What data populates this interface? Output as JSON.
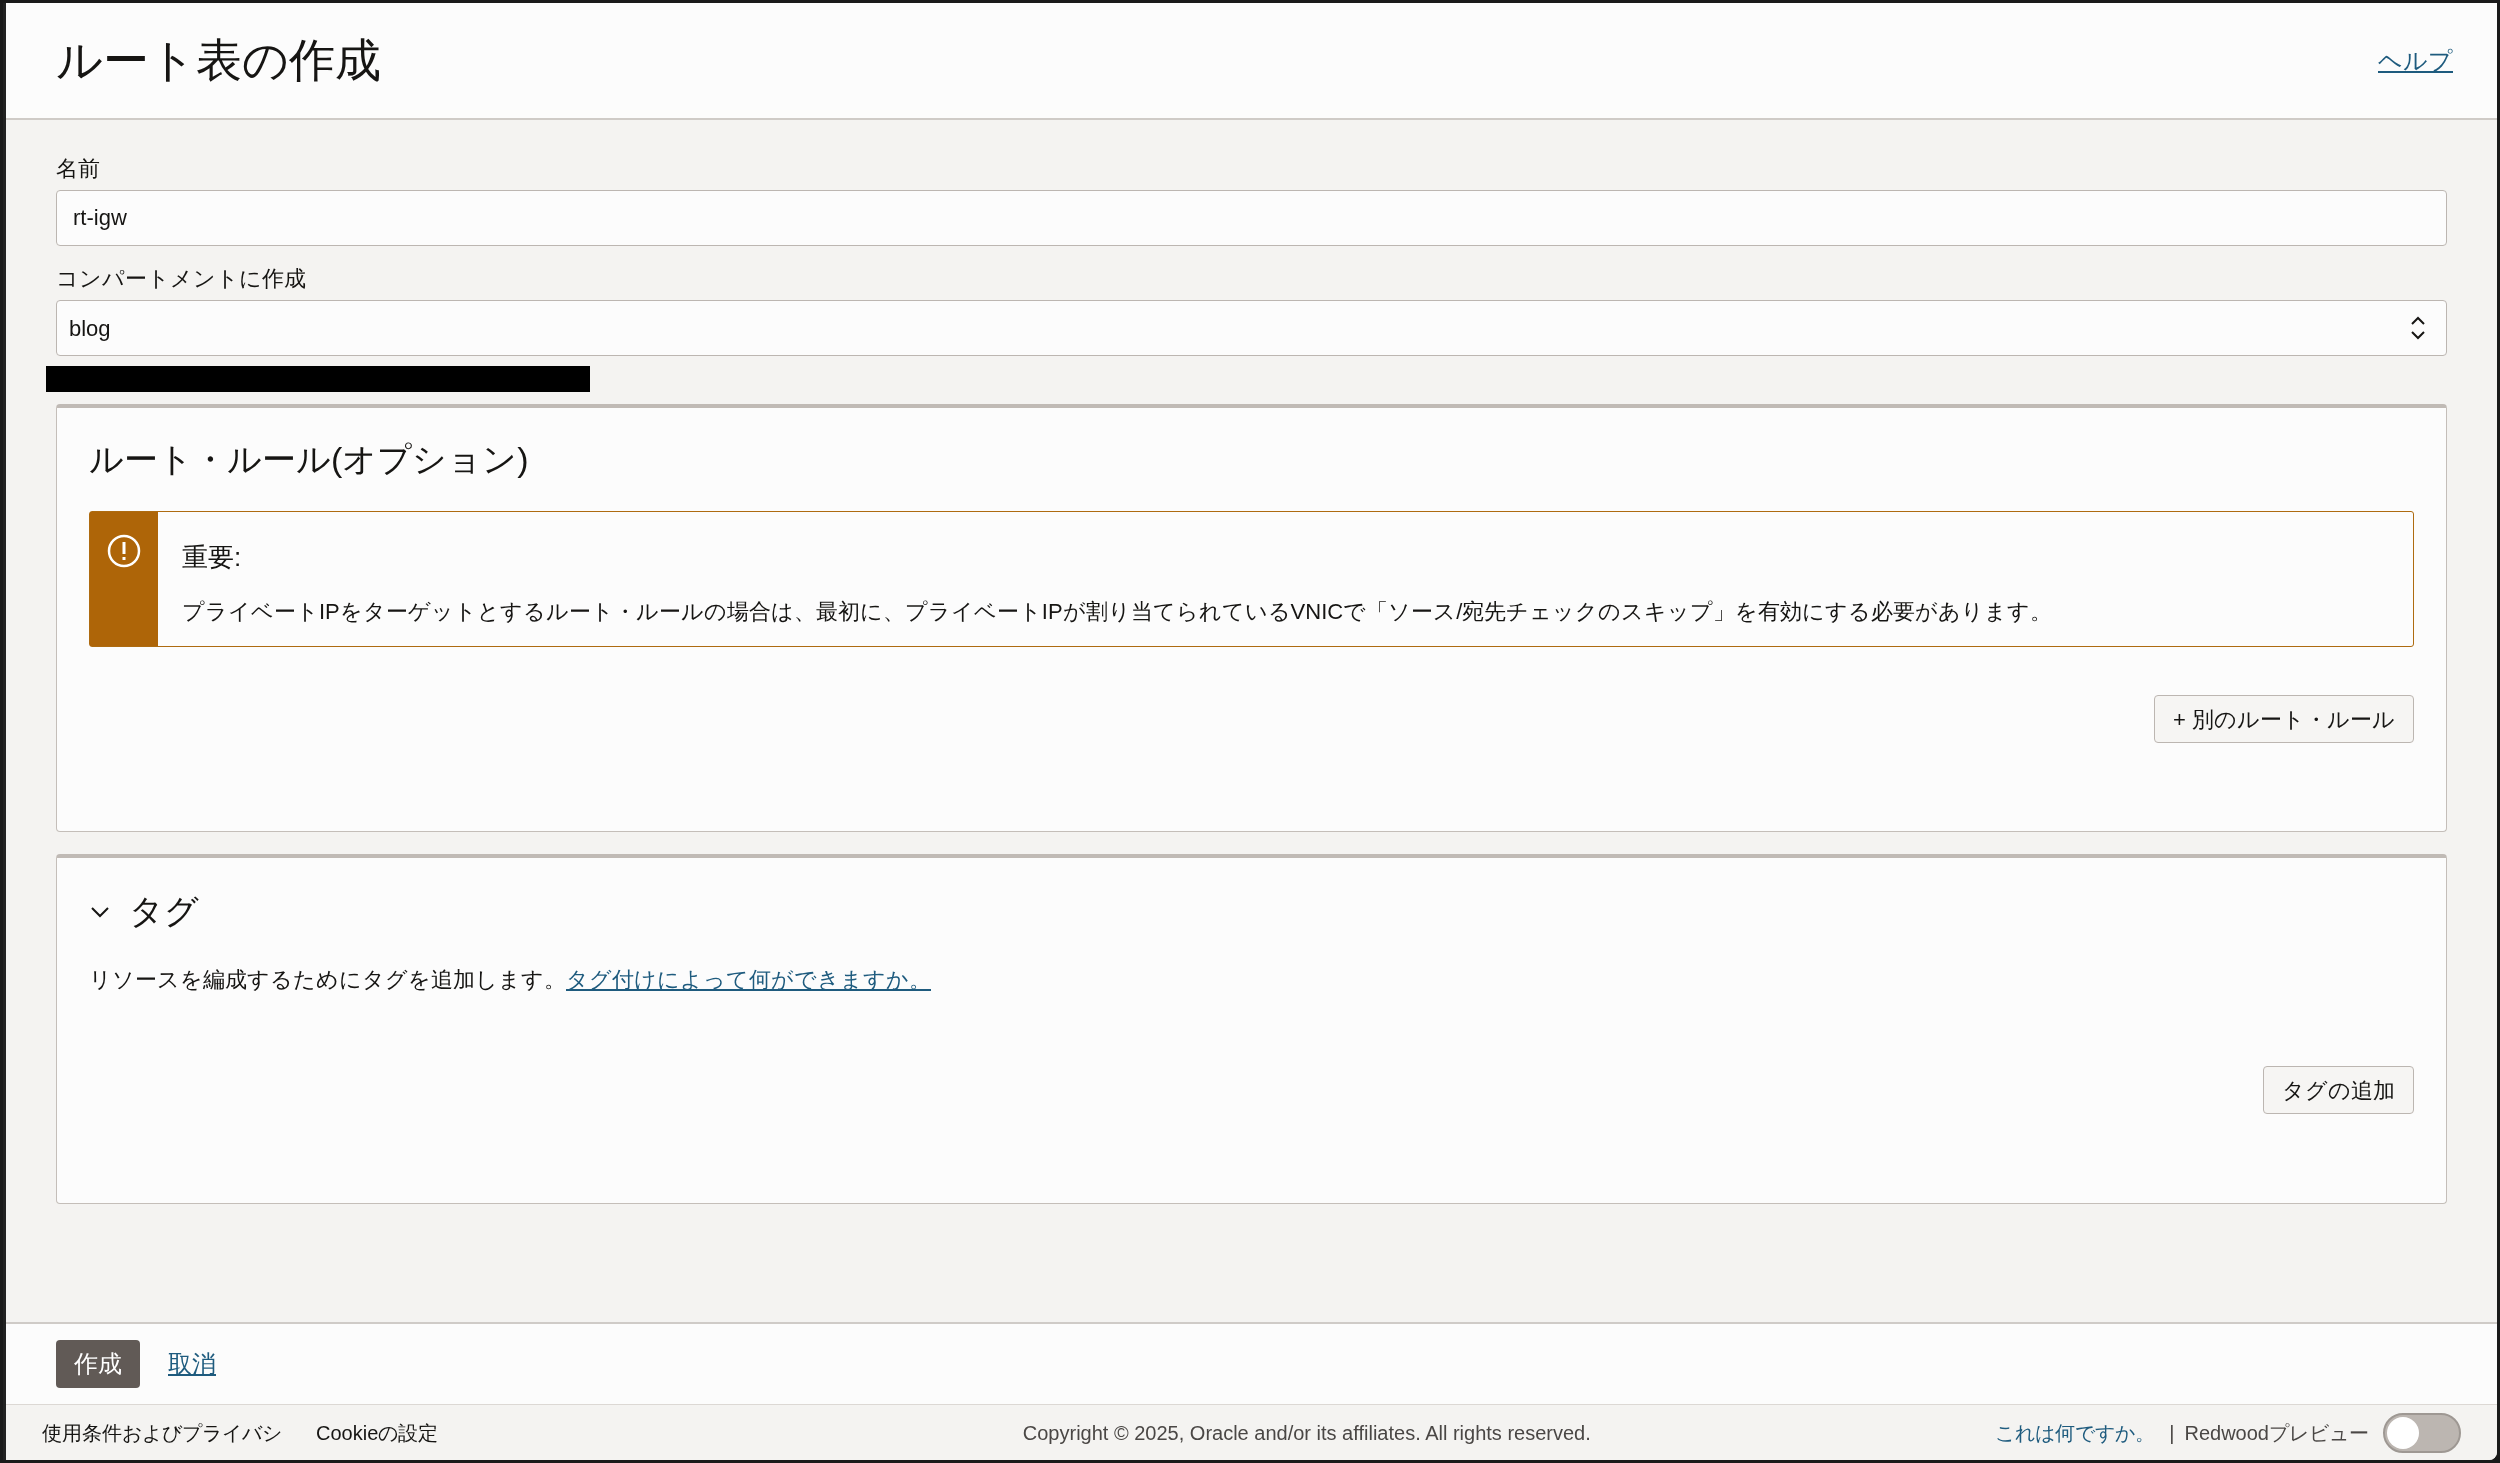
{
  "header": {
    "title": "ルート表の作成",
    "help_link": "ヘルプ"
  },
  "fields": [
    {
      "kind": "text",
      "label": "名前",
      "value": "rt-igw"
    },
    {
      "kind": "select",
      "label": "コンパートメントに作成",
      "value": "blog"
    }
  ],
  "route_rules": {
    "title": "ルート・ルール(オプション)",
    "notice": {
      "title": "重要:",
      "text": "プライベートIPをターゲットとするルート・ルールの場合は、最初に、プライベートIPが割り当てられているVNICで「ソース/宛先チェックのスキップ」を有効にする必要があります。"
    },
    "add_button": "+ 別のルート・ルール"
  },
  "tags": {
    "title": "タグ",
    "expanded": true,
    "description": "リソースを編成するためにタグを追加します。",
    "link": "タグ付けによって何ができますか。",
    "add_button": "タグの追加"
  },
  "actions": {
    "create": "作成",
    "cancel": "取消"
  },
  "footer": {
    "terms": "使用条件およびプライバシ",
    "cookies": "Cookieの設定",
    "copyright": "Copyright © 2025, Oracle and/or its affiliates. All rights reserved.",
    "whats_this": "これは何ですか。",
    "separator": "|",
    "preview_label": "Redwoodプレビュー",
    "preview_toggle": {
      "on": false
    }
  }
}
